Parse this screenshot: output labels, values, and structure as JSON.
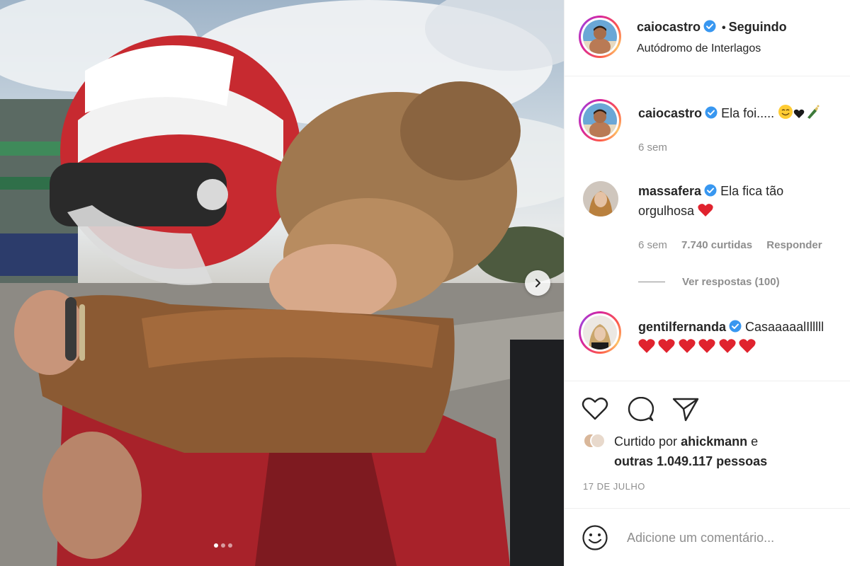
{
  "post": {
    "photo_alt": "Photo of a woman hugging a race driver in a red helmet",
    "carousel": {
      "total": 3,
      "active_index": 0
    }
  },
  "header": {
    "username": "caiocastro",
    "verified": true,
    "separator": "•",
    "follow_status": "Seguindo",
    "location": "Autódromo de Interlagos"
  },
  "comments": [
    {
      "username": "caiocastro",
      "verified": true,
      "text": "Ela foi.....",
      "emojis": [
        "smiling-face-emoji",
        "black-heart-emoji",
        "champagne-emoji"
      ],
      "time": "6 sem"
    },
    {
      "username": "massafera",
      "verified": true,
      "text_line1": "Ela fica tão",
      "text_line2": "orgulhosa",
      "emojis": [
        "red-heart-emoji"
      ],
      "time": "6 sem",
      "likes": "7.740 curtidas",
      "reply_label": "Responder",
      "view_replies": "Ver respostas (100)"
    },
    {
      "username": "gentilfernanda",
      "verified": true,
      "text": "CasaaaaalIlllll",
      "emojis": [
        "red-heart-emoji",
        "red-heart-emoji",
        "red-heart-emoji",
        "red-heart-emoji",
        "red-heart-emoji",
        "red-heart-emoji"
      ]
    }
  ],
  "actions": {
    "icons": [
      "heart-icon",
      "comment-icon",
      "share-icon"
    ]
  },
  "likes": {
    "prefix": "Curtido por",
    "user": "ahickmann",
    "connector": "e",
    "others": "outras 1.049.117 pessoas"
  },
  "date": "17 DE JULHO",
  "add_comment": {
    "placeholder": "Adicione um comentário..."
  },
  "colors": {
    "verified_blue": "#3897f0",
    "text": "#262626",
    "secondary_text": "#8e8e8e",
    "heart_red": "#ed4956"
  }
}
